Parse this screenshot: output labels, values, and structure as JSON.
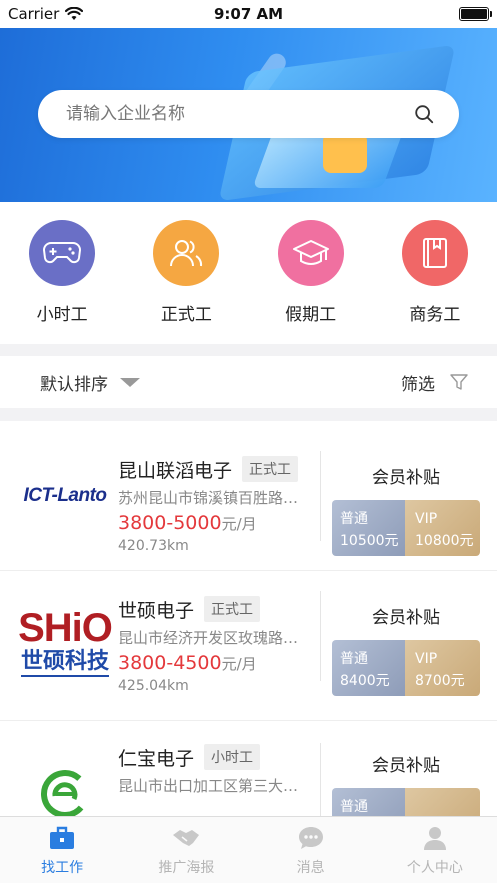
{
  "status_bar": {
    "carrier": "Carrier",
    "time": "9:07 AM"
  },
  "search": {
    "placeholder": "请输入企业名称"
  },
  "categories": [
    {
      "label": "小时工",
      "icon": "gamepad-icon",
      "color": "#6a6fc6"
    },
    {
      "label": "正式工",
      "icon": "users-icon",
      "color": "#f5a742"
    },
    {
      "label": "假期工",
      "icon": "graduation-cap-icon",
      "color": "#f070a0"
    },
    {
      "label": "商务工",
      "icon": "book-icon",
      "color": "#f06767"
    }
  ],
  "sort_bar": {
    "sort_label": "默认排序",
    "filter_label": "筛选"
  },
  "jobs": [
    {
      "company": "昆山联滔电子",
      "tag": "正式工",
      "address": "苏州昆山市锦溪镇百胜路…",
      "pay": "3800-5000",
      "pay_unit": "元/月",
      "distance": "420.73km",
      "logo_text": "ICT-Lanto",
      "member_title": "会员补贴",
      "normal_label": "普通",
      "normal_value": "10500元",
      "vip_label": "VIP",
      "vip_value": "10800元"
    },
    {
      "company": "世硕电子",
      "tag": "正式工",
      "address": "昆山市经济开发区玫瑰路…",
      "pay": "3800-4500",
      "pay_unit": "元/月",
      "distance": "425.04km",
      "logo_text_top": "SHiO",
      "logo_text_bottom": "世硕科技",
      "member_title": "会员补贴",
      "normal_label": "普通",
      "normal_value": "8400元",
      "vip_label": "VIP",
      "vip_value": "8700元"
    },
    {
      "company": "仁宝电子",
      "tag": "小时工",
      "address": "昆山市出口加工区第三大…",
      "member_title": "会员补贴",
      "normal_label": "普通"
    }
  ],
  "tabs": [
    {
      "label": "找工作",
      "icon": "briefcase-icon",
      "active": true
    },
    {
      "label": "推广海报",
      "icon": "handshake-icon",
      "active": false
    },
    {
      "label": "消息",
      "icon": "chat-bubble-icon",
      "active": false
    },
    {
      "label": "个人中心",
      "icon": "person-icon",
      "active": false
    }
  ],
  "colors": {
    "accent": "#2a7de0",
    "price": "#e4393c"
  }
}
